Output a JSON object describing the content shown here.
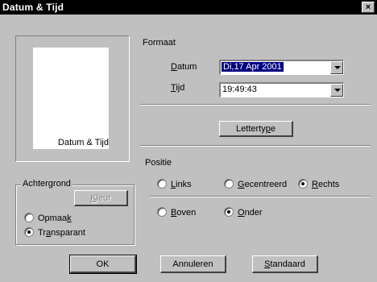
{
  "window": {
    "title": "Datum & Tijd",
    "close_glyph": "×"
  },
  "preview": {
    "text": "Datum & Tijd"
  },
  "formaat": {
    "label": "Formaat",
    "datum_pre": "",
    "datum_acc": "D",
    "datum_post": "atum",
    "datum_value": "Di,17 Apr 2001",
    "tijd_pre": "",
    "tijd_acc": "T",
    "tijd_post": "ijd",
    "tijd_value": "19:49:43"
  },
  "lettertype_button": {
    "pre": "Letterty",
    "acc": "p",
    "post": "e"
  },
  "positie": {
    "label": "Positie",
    "horizontal": [
      {
        "pre": "",
        "acc": "L",
        "post": "inks",
        "checked": false
      },
      {
        "pre": "",
        "acc": "G",
        "post": "ecentreerd",
        "checked": false
      },
      {
        "pre": "",
        "acc": "R",
        "post": "echts",
        "checked": true
      }
    ],
    "vertical": [
      {
        "pre": "",
        "acc": "B",
        "post": "oven",
        "checked": false
      },
      {
        "pre": "",
        "acc": "O",
        "post": "nder",
        "checked": true
      }
    ]
  },
  "achtergrond": {
    "label": "Achtergrond",
    "kleur": {
      "pre": "",
      "acc": "K",
      "post": "leur"
    },
    "options": [
      {
        "pre": "Opmaa",
        "acc": "k",
        "post": "",
        "checked": false
      },
      {
        "pre": "Tr",
        "acc": "a",
        "post": "nsparant",
        "checked": true
      }
    ]
  },
  "buttons": {
    "ok": "OK",
    "annuleren": "Annuleren",
    "standaard": {
      "pre": "",
      "acc": "S",
      "post": "tandaard"
    }
  }
}
